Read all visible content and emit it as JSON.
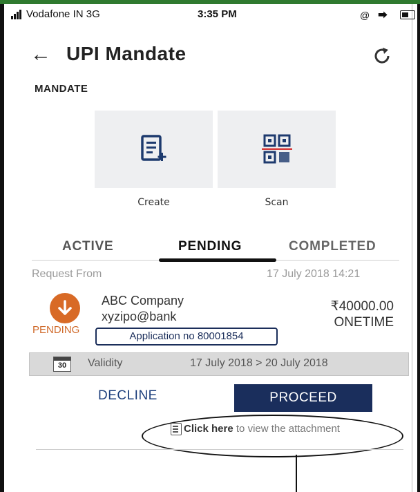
{
  "status_bar": {
    "carrier": "Vodafone IN  3G",
    "time": "3:35 PM",
    "icons": "@ ⮕"
  },
  "header": {
    "back_icon": "←",
    "title": "UPI Mandate",
    "refresh_icon": "refresh-icon"
  },
  "section": {
    "label": "MANDATE"
  },
  "actions": [
    {
      "label": "Create",
      "icon": "create-document-icon"
    },
    {
      "label": "Scan",
      "icon": "qr-scan-icon"
    }
  ],
  "tabs": [
    {
      "label": "ACTIVE"
    },
    {
      "label": "PENDING",
      "selected": true
    },
    {
      "label": "COMPLETED"
    }
  ],
  "request": {
    "from_label": "Request From",
    "date": "17 July 2018 14:21",
    "status": "PENDING",
    "company": "ABC Company",
    "vpa": "xyzipo@bank",
    "amount": "₹40000.00",
    "frequency": "ONETIME",
    "application": "Application no 80001854"
  },
  "validity": {
    "calendar_day": "30",
    "label": "Validity",
    "range": "17 July 2018 > 20 July 2018"
  },
  "buttons": {
    "decline": "DECLINE",
    "proceed": "PROCEED"
  },
  "attachment": {
    "click_here": "Click here",
    "rest": " to view the attachment"
  },
  "colors": {
    "primary": "#1a2e5c",
    "pending": "#d86a26",
    "tile_bg": "#eeeff1"
  }
}
